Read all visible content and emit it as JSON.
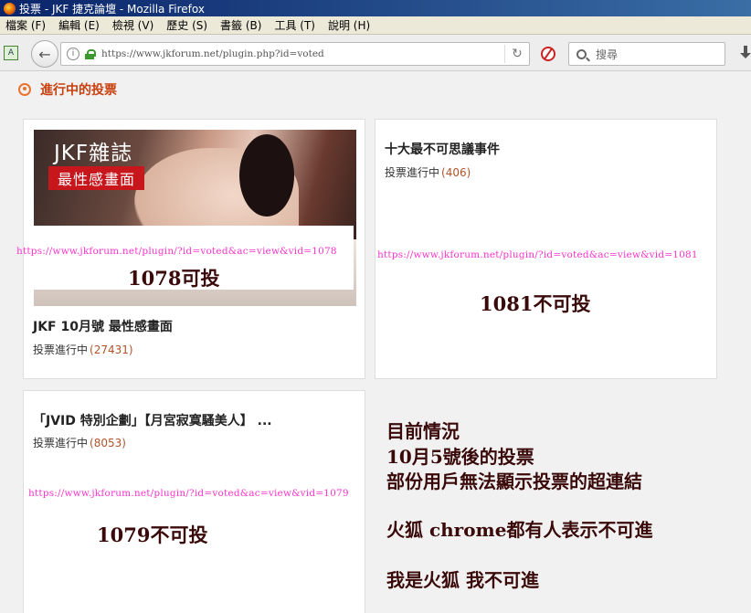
{
  "window": {
    "title": "投票 - JKF 捷克論壇 - Mozilla Firefox"
  },
  "menu": [
    "檔案 (F)",
    "編輯 (E)",
    "檢視 (V)",
    "歷史 (S)",
    "書籤 (B)",
    "工具 (T)",
    "說明 (H)"
  ],
  "nav": {
    "url": "https://www.jkforum.net/plugin.php?id=voted",
    "search_placeholder": "搜尋"
  },
  "section": {
    "title": "進行中的投票"
  },
  "polls": [
    {
      "image_title": "JKF雜誌",
      "image_badge": "最性感畫面",
      "title": "JKF 10月號 最性感畫面",
      "status": "投票進行中",
      "count": "(27431)",
      "note_url": "https://www.jkforum.net/plugin/?id=voted&ac=view&vid=1078",
      "note_status": "1078可投"
    },
    {
      "title": "十大最不可思議事件",
      "status": "投票進行中",
      "count": "(406)",
      "note_url": "https://www.jkforum.net/plugin/?id=voted&ac=view&vid=1081",
      "note_status": "1081不可投"
    },
    {
      "title": "「JVID 特別企劃」【月宮寂寞騷美人】 ...",
      "status": "投票進行中",
      "count": "(8053)",
      "note_url": "https://www.jkforum.net/plugin/?id=voted&ac=view&vid=1079",
      "note_status": "1079不可投"
    }
  ],
  "annotation": {
    "lines": [
      "目前情況",
      "10月5號後的投票",
      "部份用戶無法顯示投票的超連結",
      "火狐 chrome都有人表示不可進",
      "我是火狐 我不可進"
    ]
  }
}
